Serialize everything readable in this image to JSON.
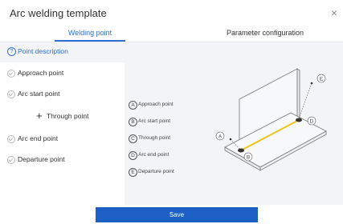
{
  "dialog": {
    "title": "Arc welding template",
    "close_glyph": "×"
  },
  "tabs": [
    {
      "label": "Welding point",
      "active": true
    },
    {
      "label": "Parameter configuration",
      "active": false
    }
  ],
  "description": {
    "icon": "question-circle-icon",
    "icon_glyph": "?",
    "label": "Point description"
  },
  "points": [
    {
      "label": "Approach point",
      "icon": "check-circle-icon"
    },
    {
      "label": "Arc start point",
      "icon": "check-circle-icon"
    },
    {
      "label": "Through point",
      "icon": "plus-icon",
      "glyph": "+"
    },
    {
      "label": "Arc end point",
      "icon": "check-circle-icon"
    },
    {
      "label": "Departure point",
      "icon": "check-circle-icon"
    }
  ],
  "legend": [
    {
      "letter": "A",
      "label": "Approach point"
    },
    {
      "letter": "B",
      "label": "Arc start point"
    },
    {
      "letter": "C",
      "label": "Through point"
    },
    {
      "letter": "D",
      "label": "Arc end point"
    },
    {
      "letter": "E",
      "label": "Departure point"
    }
  ],
  "diagram": {
    "markers": [
      "A",
      "B",
      "D",
      "E"
    ],
    "weld_line_color": "#f0c419"
  },
  "footer": {
    "save_label": "Save"
  },
  "colors": {
    "accent": "#2f6fd6",
    "button": "#1d5fc4"
  }
}
